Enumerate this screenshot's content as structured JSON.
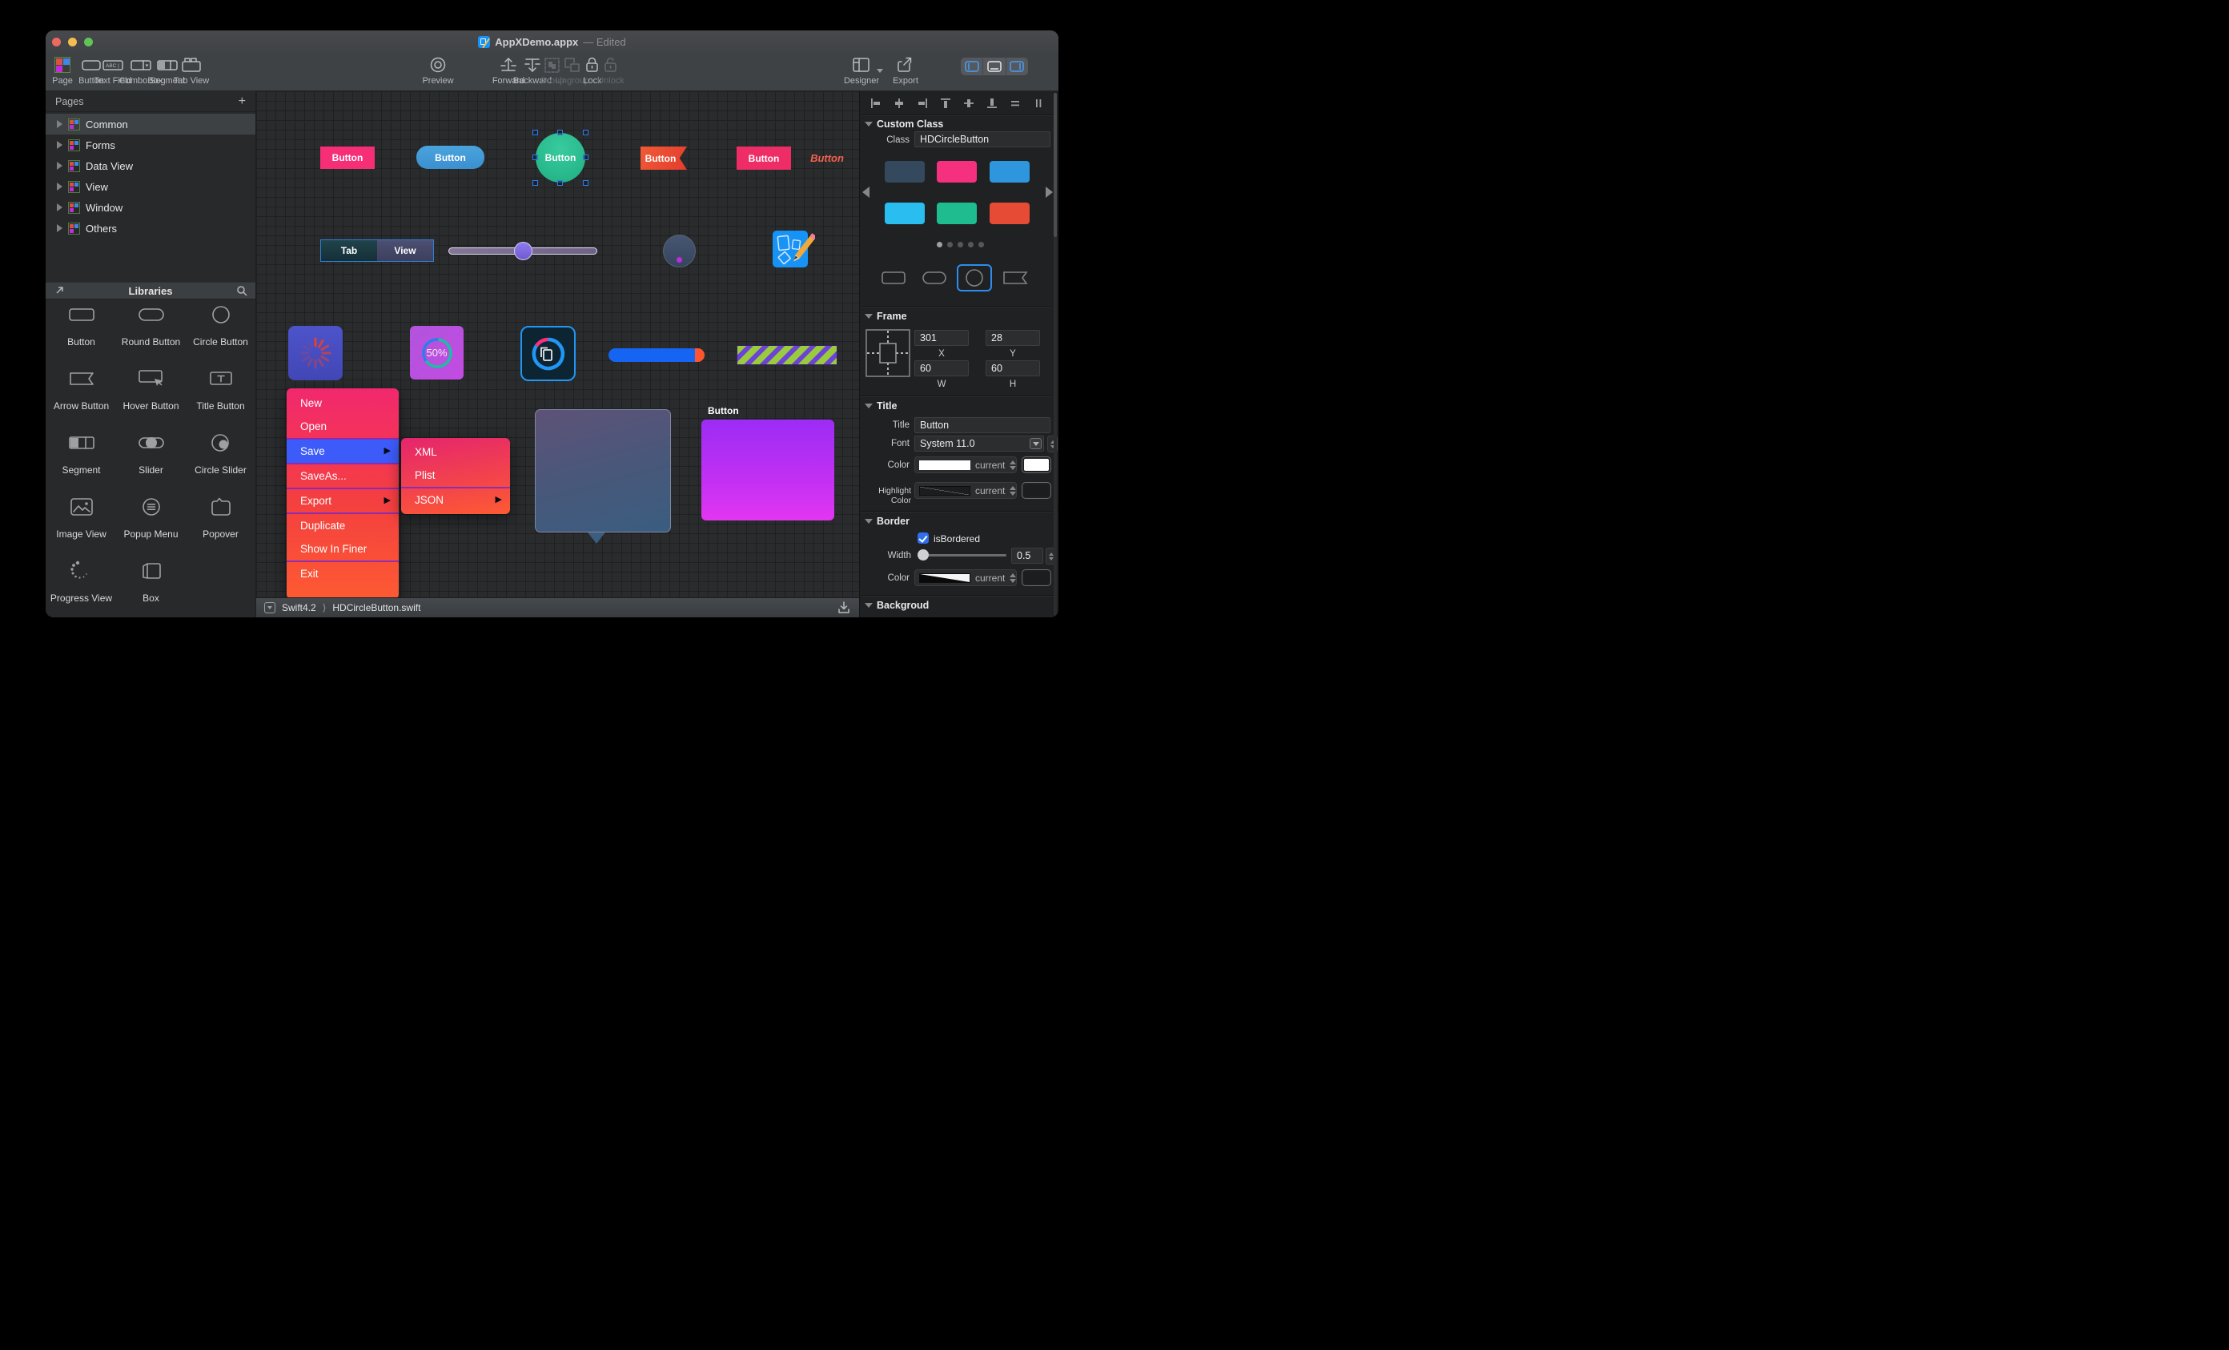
{
  "window": {
    "title": "AppXDemo.appx",
    "edited": "— Edited"
  },
  "toolbar": {
    "page": "Page",
    "button": "Button",
    "text_field": "Text Field",
    "combobox": "ComboBox",
    "segment": "Segment",
    "tab_view": "Tab View",
    "preview": "Preview",
    "forward": "Forward",
    "backward": "Backward",
    "group": "Group",
    "ungroup": "Ungroup",
    "lock": "Lock",
    "unlock": "Unlock",
    "designer": "Designer",
    "export": "Export"
  },
  "sidebar": {
    "pages": {
      "header": "Pages",
      "add": "+",
      "items": [
        {
          "label": "Common"
        },
        {
          "label": "Forms"
        },
        {
          "label": "Data View"
        },
        {
          "label": "View"
        },
        {
          "label": "Window"
        },
        {
          "label": "Others"
        }
      ]
    },
    "libraries": {
      "header": "Libraries",
      "items": [
        {
          "label": "Button"
        },
        {
          "label": "Round Button"
        },
        {
          "label": "Circle Button"
        },
        {
          "label": "Arrow Button"
        },
        {
          "label": "Hover Button"
        },
        {
          "label": "Title Button"
        },
        {
          "label": "Segment"
        },
        {
          "label": "Slider"
        },
        {
          "label": "Circle Slider"
        },
        {
          "label": "Image View"
        },
        {
          "label": "Popup Menu"
        },
        {
          "label": "Popover"
        },
        {
          "label": "Progress View"
        },
        {
          "label": "Box"
        }
      ]
    }
  },
  "canvas": {
    "buttons": {
      "rect_pink": "Button",
      "round_blue": "Button",
      "circle_green": "Button",
      "ribbon": "Button",
      "rect_pink2": "Button",
      "italic": "Button"
    },
    "segmented": {
      "tab": "Tab",
      "view": "View"
    },
    "progress_tile": {
      "value": "50%"
    },
    "floating_button": {
      "label": "Button"
    },
    "menu": {
      "items": [
        "New",
        "Open",
        "Save",
        "SaveAs...",
        "Export",
        "Duplicate",
        "Show In Finer",
        "Exit"
      ]
    },
    "submenu": {
      "items": [
        "XML",
        "Plist",
        "JSON"
      ]
    }
  },
  "statusbar": {
    "language": "Swift4.2",
    "separator": "⟩",
    "file": "HDCircleButton.swift"
  },
  "inspector": {
    "custom_class": {
      "header": "Custom Class",
      "class_label": "Class",
      "class_value": "HDCircleButton",
      "swatches": [
        "#35495E",
        "#F5317F",
        "#2D96DC",
        "#29BDF0",
        "#1FBC8F",
        "#E64B35"
      ]
    },
    "frame": {
      "header": "Frame",
      "x": "301",
      "y": "28",
      "w": "60",
      "h": "60",
      "x_label": "X",
      "y_label": "Y",
      "w_label": "W",
      "h_label": "H"
    },
    "title": {
      "header": "Title",
      "title_label": "Title",
      "title_value": "Button",
      "font_label": "Font",
      "font_value": "System 11.0",
      "color_label": "Color",
      "color_value": "current",
      "highlight_label": "Highlight Color",
      "highlight_value": "current"
    },
    "border": {
      "header": "Border",
      "checkbox_label": "isBordered",
      "width_label": "Width",
      "width_value": "0.5",
      "color_label": "Color",
      "color_value": "current"
    },
    "background": {
      "header": "Backgroud"
    }
  }
}
